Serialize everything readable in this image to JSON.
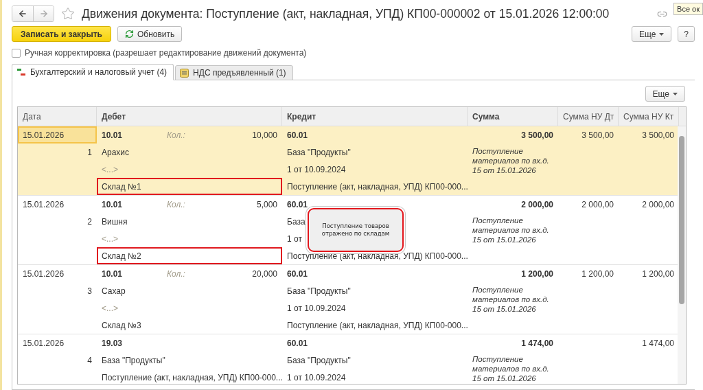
{
  "window": {
    "title": "Движения документа: Поступление (акт, накладная, УПД) КП00-000002 от 15.01.2026 12:00:00",
    "tooltip": "Все ок"
  },
  "toolbar": {
    "primary": "Записать и закрыть",
    "refresh": "Обновить",
    "more": "Еще",
    "help": "?"
  },
  "manual_edit": {
    "label": "Ручная корректировка (разрешает редактирование движений документа)",
    "checked": false
  },
  "tabs": [
    {
      "label": "Бухгалтерский и налоговый учет (4)",
      "kind": "ledger",
      "selected": true
    },
    {
      "label": "НДС предъявленный (1)",
      "kind": "vat",
      "selected": false
    }
  ],
  "panel_more": "Еще",
  "table": {
    "columns": [
      {
        "label": "Дата",
        "bold": false
      },
      {
        "label": "Дебет",
        "bold": true
      },
      {
        "label": "Кредит",
        "bold": true
      },
      {
        "label": "Сумма",
        "bold": true
      },
      {
        "label": "Сумма НУ Дт",
        "bold": false
      },
      {
        "label": "Сумма НУ Кт",
        "bold": false
      }
    ],
    "rows": [
      {
        "selected": true,
        "date": "15.01.2026",
        "number": "1",
        "debit": {
          "account": "10.01",
          "qty_label": "Кол.:",
          "qty": "10,000",
          "subconto": [
            {
              "text": "Арахис",
              "empty": false,
              "highlighted": false
            },
            {
              "text": "<...>",
              "empty": true,
              "highlighted": false
            },
            {
              "text": "Склад №1",
              "empty": false,
              "highlighted": true
            }
          ]
        },
        "credit": {
          "account": "60.01",
          "subconto": [
            {
              "text": "База \"Продукты\"",
              "empty": false,
              "highlighted": false
            },
            {
              "text": "1 от 10.09.2024",
              "empty": false,
              "highlighted": false
            },
            {
              "text": "Поступление (акт, накладная, УПД) КП00-000...",
              "empty": false,
              "highlighted": false
            }
          ]
        },
        "sum": "3 500,00",
        "comment": "Поступление материалов по вх.д. 15 от 15.01.2026",
        "sum_nu_dt": "3 500,00",
        "sum_nu_kt": "3 500,00"
      },
      {
        "selected": false,
        "date": "15.01.2026",
        "number": "2",
        "debit": {
          "account": "10.01",
          "qty_label": "Кол.:",
          "qty": "5,000",
          "subconto": [
            {
              "text": "Вишня",
              "empty": false,
              "highlighted": false
            },
            {
              "text": "<...>",
              "empty": true,
              "highlighted": false
            },
            {
              "text": "Склад №2",
              "empty": false,
              "highlighted": true
            }
          ]
        },
        "credit": {
          "account": "60.01",
          "subconto": [
            {
              "text": "База",
              "empty": false,
              "highlighted": false
            },
            {
              "text": "1 от",
              "empty": false,
              "highlighted": false
            },
            {
              "text": "Поступление (акт, накладная, УПД) КП00-000...",
              "empty": false,
              "highlighted": false
            }
          ]
        },
        "sum": "2 000,00",
        "comment": "Поступление материалов по вх.д. 15 от 15.01.2026",
        "sum_nu_dt": "2 000,00",
        "sum_nu_kt": "2 000,00"
      },
      {
        "selected": false,
        "date": "15.01.2026",
        "number": "3",
        "debit": {
          "account": "10.01",
          "qty_label": "Кол.:",
          "qty": "20,000",
          "subconto": [
            {
              "text": "Сахар",
              "empty": false,
              "highlighted": false
            },
            {
              "text": "<...>",
              "empty": true,
              "highlighted": false
            },
            {
              "text": "Склад №3",
              "empty": false,
              "highlighted": false
            }
          ]
        },
        "credit": {
          "account": "60.01",
          "subconto": [
            {
              "text": "База \"Продукты\"",
              "empty": false,
              "highlighted": false
            },
            {
              "text": "1 от 10.09.2024",
              "empty": false,
              "highlighted": false
            },
            {
              "text": "Поступление (акт, накладная, УПД) КП00-000...",
              "empty": false,
              "highlighted": false
            }
          ]
        },
        "sum": "1 200,00",
        "comment": "Поступление материалов по вх.д. 15 от 15.01.2026",
        "sum_nu_dt": "1 200,00",
        "sum_nu_kt": "1 200,00"
      },
      {
        "selected": false,
        "date": "15.01.2026",
        "number": "4",
        "debit": {
          "account": "19.03",
          "subconto": [
            {
              "text": "База \"Продукты\"",
              "empty": false,
              "highlighted": false
            },
            {
              "text": "Поступление (акт, накладная, УПД) КП00-000...",
              "empty": false,
              "highlighted": false
            }
          ]
        },
        "credit": {
          "account": "60.01",
          "subconto": [
            {
              "text": "База \"Продукты\"",
              "empty": false,
              "highlighted": false
            },
            {
              "text": "1 от 10.09.2024",
              "empty": false,
              "highlighted": false
            }
          ]
        },
        "sum": "1 474,00",
        "comment": "Поступление материалов по вх.д. 15 от 15.01.2026",
        "sum_nu_kt": "1 474,00"
      }
    ]
  },
  "callout": {
    "text": "Поступление товаров отражено по складам"
  }
}
